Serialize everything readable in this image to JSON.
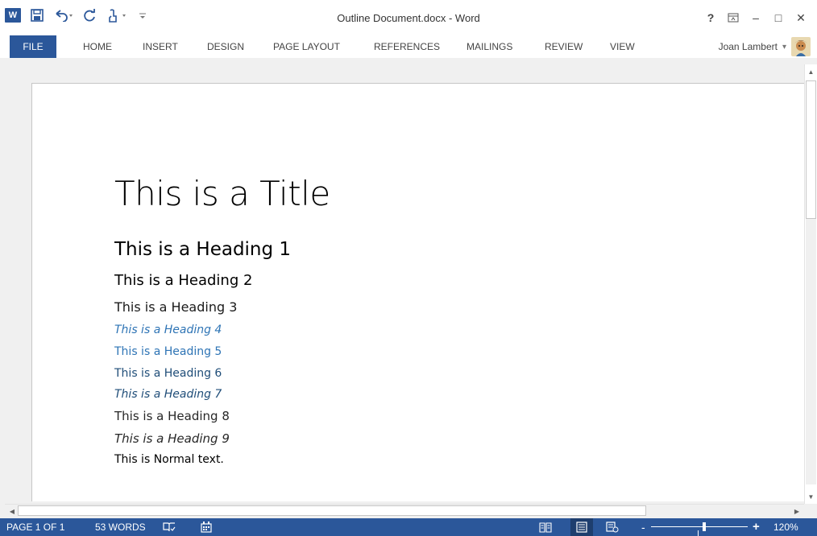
{
  "window": {
    "title": "Outline Document.docx - Word",
    "help": "?",
    "ribbon_display": "⊼",
    "minimize": "–",
    "maximize": "□",
    "close": "✕"
  },
  "qat": {
    "app_icon": "word-logo-icon",
    "app_letter": "W",
    "save": "save-icon",
    "undo": "undo-icon",
    "redo": "redo-icon",
    "touch": "touch-mode-icon",
    "customize": "customize-qat-icon"
  },
  "tabs": {
    "file": "FILE",
    "home": "HOME",
    "insert": "INSERT",
    "design": "DESIGN",
    "page_layout": "PAGE LAYOUT",
    "references": "REFERENCES",
    "mailings": "MAILINGS",
    "review": "REVIEW",
    "view": "VIEW"
  },
  "user": {
    "name": "Joan Lambert",
    "dropdown": "▾"
  },
  "document": {
    "title": "This is a Title",
    "h1": "This is a Heading 1",
    "h2": "This is a Heading 2",
    "h3": "This is a Heading 3",
    "h4": "This is a Heading 4",
    "h5": "This is a Heading 5",
    "h6": "This is a Heading 6",
    "h7": "This is a Heading 7",
    "h8": "This is a Heading 8",
    "h9": "This is a Heading 9",
    "normal": "This is Normal text."
  },
  "status": {
    "page": "PAGE 1 OF 1",
    "words": "53 WORDS",
    "zoom_minus": "-",
    "zoom_plus": "+",
    "zoom_level": "120%",
    "zoom_fraction": 0.5
  },
  "colors": {
    "brand": "#2b579a",
    "heading_accent": "#2e74b5",
    "heading_dark": "#1f4d78"
  }
}
